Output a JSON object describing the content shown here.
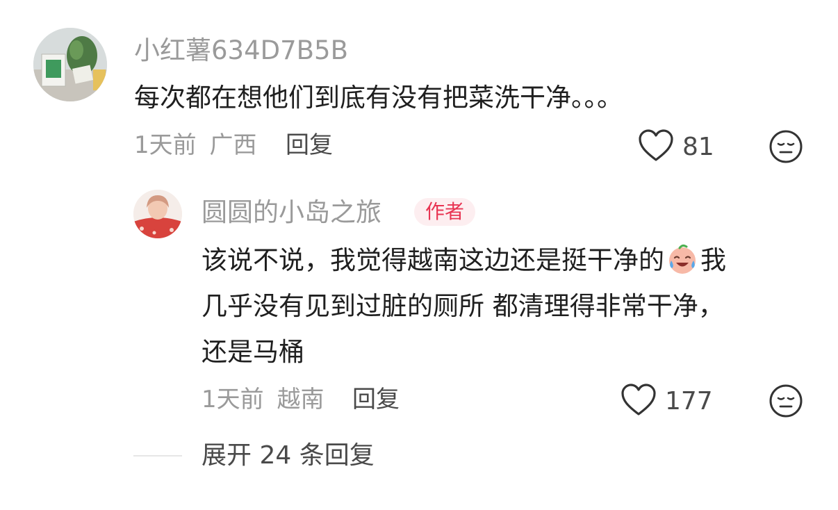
{
  "comment": {
    "username": "小红薯634D7B5B",
    "text": "每次都在想他们到底有没有把菜洗干净。。。",
    "time": "1天前",
    "location": "广西",
    "reply_label": "回复",
    "likes": "81"
  },
  "reply": {
    "username": "圆圆的小岛之旅",
    "badge": "作者",
    "text_lines": [
      "该说不说，我觉得越南这边还是挺干净的",
      "我",
      "几乎没有见到过脏的厕所 都清理得非常干净，",
      "还是马桶"
    ],
    "time": "1天前",
    "location": "越南",
    "reply_label": "回复",
    "likes": "177"
  },
  "expand": {
    "label": "展开 24 条回复"
  },
  "icons": {
    "like": "heart-outline-icon",
    "dislike": "neutral-face-icon",
    "emoji": "crying-laughing-emoji"
  },
  "colors": {
    "meta_gray": "#9a9a9a",
    "text_dark": "#1f1f1f",
    "badge_bg": "#fdeef0",
    "badge_text": "#e83452"
  }
}
